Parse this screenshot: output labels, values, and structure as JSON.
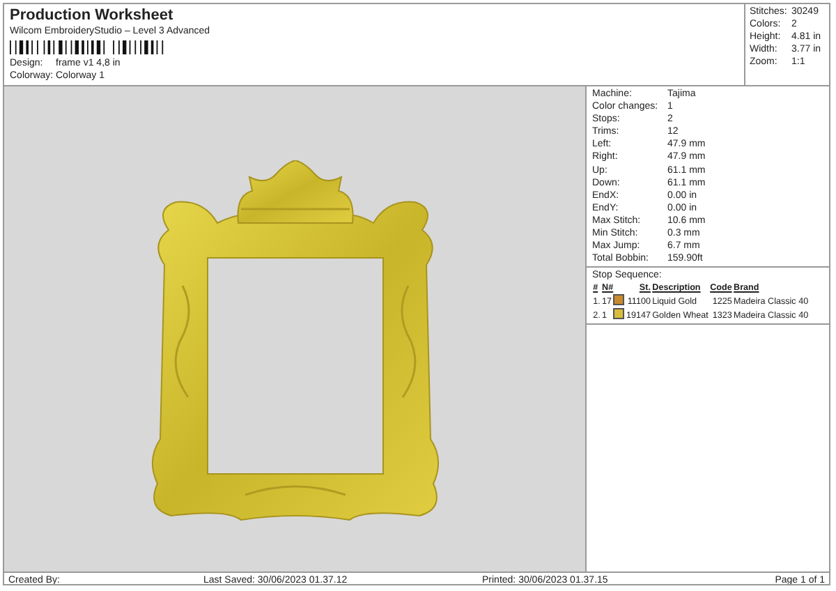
{
  "header": {
    "title": "Production Worksheet",
    "subtitle": "Wilcom EmbroideryStudio – Level 3 Advanced",
    "fields": [
      {
        "label": "Design:",
        "value": "frame v1 4,8 in"
      },
      {
        "label": "Colorway:",
        "value": "Colorway 1"
      }
    ]
  },
  "summary": [
    {
      "label": "Stitches:",
      "value": "30249"
    },
    {
      "label": "Colors:",
      "value": "2"
    },
    {
      "label": "Height:",
      "value": "4.81 in"
    },
    {
      "label": "Width:",
      "value": "3.77 in"
    },
    {
      "label": "Zoom:",
      "value": "1:1"
    }
  ],
  "details": [
    {
      "label": "Machine:",
      "value": "Tajima"
    },
    {
      "label": "Color changes:",
      "value": "1"
    },
    {
      "label": "Stops:",
      "value": "2"
    },
    {
      "label": "Trims:",
      "value": "12"
    },
    {
      "label": "Left:",
      "value": "47.9 mm"
    },
    {
      "label": "Right:",
      "value": "47.9 mm"
    },
    {
      "label": "Up:",
      "value": "61.1 mm"
    },
    {
      "label": "Down:",
      "value": "61.1 mm"
    },
    {
      "label": "EndX:",
      "value": "0.00 in"
    },
    {
      "label": "EndY:",
      "value": "0.00 in"
    },
    {
      "label": "Max Stitch:",
      "value": "10.6 mm"
    },
    {
      "label": "Min Stitch:",
      "value": "0.3 mm"
    },
    {
      "label": "Max Jump:",
      "value": "6.7 mm"
    },
    {
      "label": "Total Bobbin:",
      "value": "159.90ft"
    }
  ],
  "stop_sequence": {
    "title": "Stop Sequence:",
    "columns": [
      "#",
      "N#",
      "St.",
      "Description",
      "Code",
      "Brand"
    ],
    "rows": [
      {
        "index": "1.",
        "needle": "17",
        "color": "#c98a2e",
        "stitches": "11100",
        "description": "Liquid Gold",
        "code": "1225",
        "brand": "Madeira Classic 40"
      },
      {
        "index": "2.",
        "needle": "1",
        "color": "#d8bd3a",
        "stitches": "19147",
        "description": "Golden Wheat",
        "code": "1323",
        "brand": "Madeira Classic 40"
      }
    ]
  },
  "footer": {
    "created_by": "Created By:",
    "last_saved": "Last Saved: 30/06/2023 01.37.12",
    "printed": "Printed: 30/06/2023 01.37.15",
    "page": "Page 1 of 1"
  }
}
